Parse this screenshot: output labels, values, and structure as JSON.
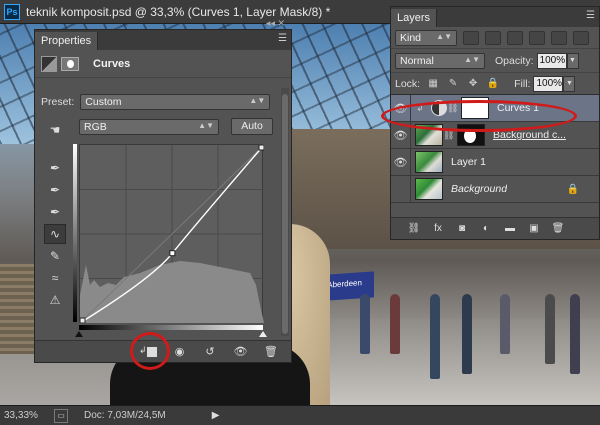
{
  "window": {
    "app_icon": "Ps",
    "title": "teknik komposit.psd @ 33,3% (Curves 1, Layer Mask/8) *"
  },
  "canvas": {
    "banner_text": "ome to Aberdeen"
  },
  "status": {
    "zoom": "33,33%",
    "doc_info": "Doc: 7,03M/24,5M"
  },
  "properties": {
    "tab": "Properties",
    "type_name": "Curves",
    "preset_label": "Preset:",
    "preset_value": "Custom",
    "channel_value": "RGB",
    "auto_label": "Auto",
    "curve": {
      "points": [
        [
          0,
          0
        ],
        [
          128,
          100
        ],
        [
          255,
          255
        ]
      ],
      "range": [
        0,
        255
      ]
    }
  },
  "layers": {
    "tab": "Layers",
    "kind_value": "Kind",
    "blend_mode": "Normal",
    "opacity_label": "Opacity:",
    "opacity_value": "100%",
    "lock_label": "Lock:",
    "fill_label": "Fill:",
    "fill_value": "100%",
    "rows": [
      {
        "name": "Curves 1",
        "selected": true,
        "visible": true
      },
      {
        "name": "Background c...",
        "selected": false,
        "visible": true
      },
      {
        "name": "Layer 1",
        "selected": false,
        "visible": true
      },
      {
        "name": "Background",
        "selected": false,
        "visible": false
      }
    ]
  },
  "highlight_color": "#d11a1a",
  "selection_color": "#6c7488"
}
